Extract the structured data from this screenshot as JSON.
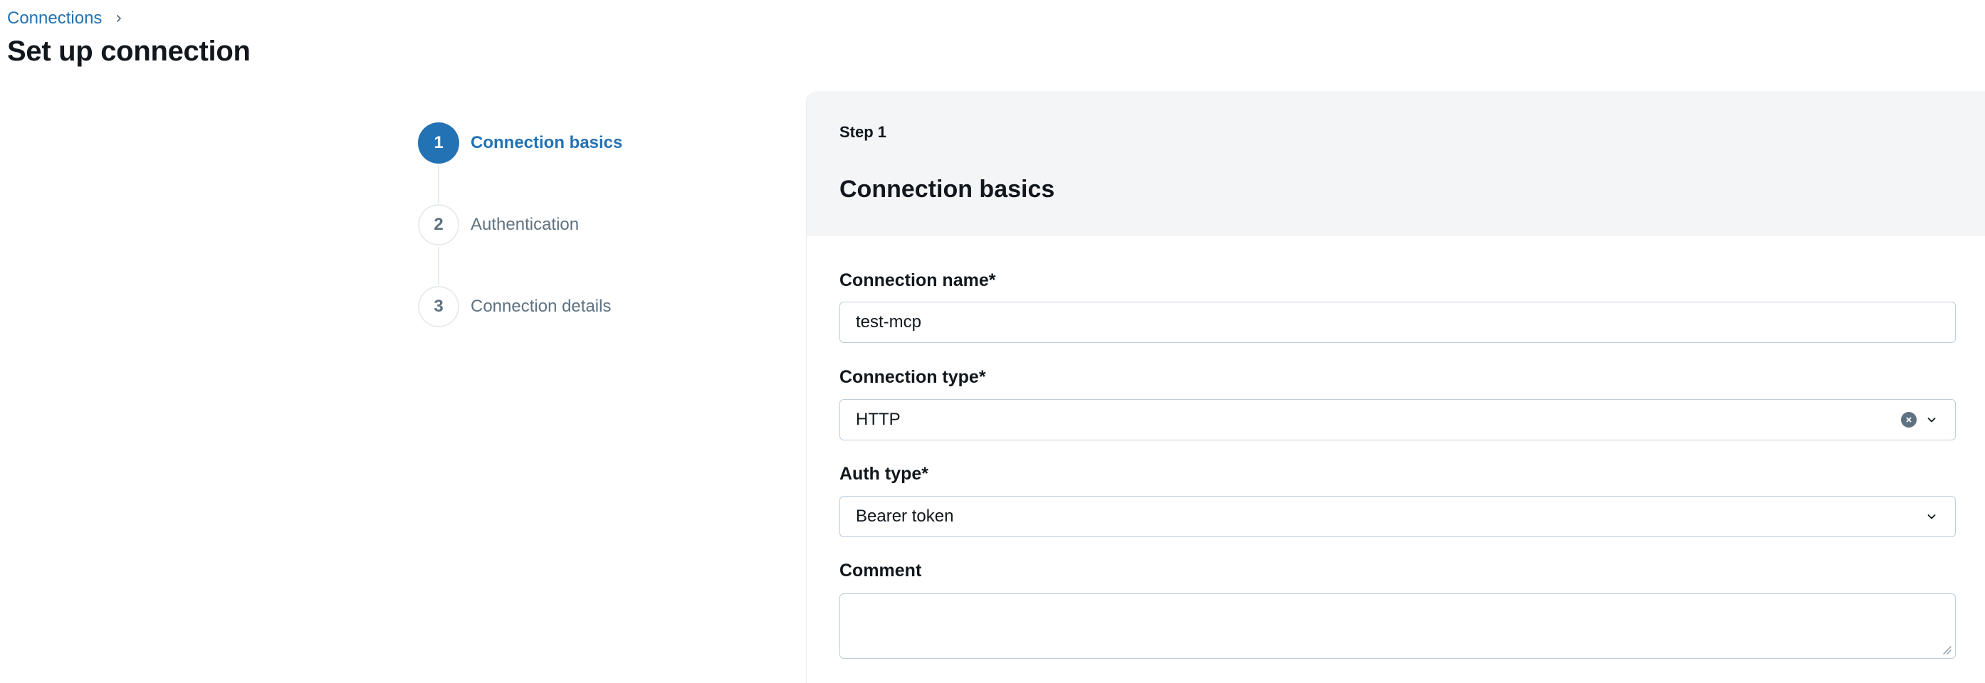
{
  "breadcrumb": {
    "link_label": "Connections"
  },
  "page": {
    "title": "Set up connection"
  },
  "stepper": {
    "steps": [
      {
        "number": "1",
        "label": "Connection basics",
        "state": "active"
      },
      {
        "number": "2",
        "label": "Authentication",
        "state": "inactive"
      },
      {
        "number": "3",
        "label": "Connection details",
        "state": "inactive"
      }
    ]
  },
  "panel": {
    "step_number": "Step 1",
    "title": "Connection basics",
    "fields": {
      "connection_name": {
        "label": "Connection name*",
        "value": "test-mcp"
      },
      "connection_type": {
        "label": "Connection type*",
        "value": "HTTP"
      },
      "auth_type": {
        "label": "Auth type*",
        "value": "Bearer token"
      },
      "comment": {
        "label": "Comment",
        "value": ""
      }
    }
  },
  "colors": {
    "accent": "#2272b4",
    "header_bg": "#f4f5f7",
    "muted_text": "#5f7281",
    "border": "#c0cdd8"
  },
  "icons": {
    "breadcrumb_separator": "chevron-right-icon",
    "clear": "clear-icon",
    "dropdown": "chevron-down-icon"
  }
}
